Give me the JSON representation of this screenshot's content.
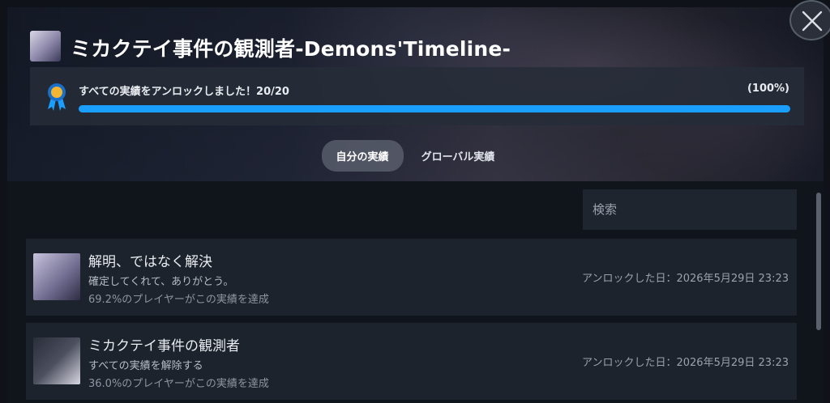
{
  "game": {
    "title": "ミカクテイ事件の観測者-Demons'Timeline-",
    "icon": "game-cover-icon"
  },
  "progress": {
    "text": "すべての実績をアンロックしました！20/20",
    "percent_label": "(100%)",
    "fraction": 1.0,
    "bar_color": "#1a9fff"
  },
  "tabs": [
    {
      "label": "自分の実績",
      "active": true
    },
    {
      "label": "グローバル実績",
      "active": false
    }
  ],
  "search": {
    "placeholder": "検索",
    "value": ""
  },
  "achievements": [
    {
      "title": "解明、ではなく解決",
      "description": "確定してくれて、ありがとう。",
      "global_pct": "69.2%のプレイヤーがこの実績を達成",
      "unlock_date": "アンロックした日：2026年5月29日 23:23",
      "icon": "achievement-headphones-girl-icon"
    },
    {
      "title": "ミカクテイ事件の観測者",
      "description": "すべての実績を解除する",
      "global_pct": "36.0%のプレイヤーがこの実績を達成",
      "unlock_date": "アンロックした日：2026年5月29日 23:23",
      "icon": "achievement-catgirl-box-icon"
    }
  ],
  "close": {
    "icon": "close-icon"
  }
}
